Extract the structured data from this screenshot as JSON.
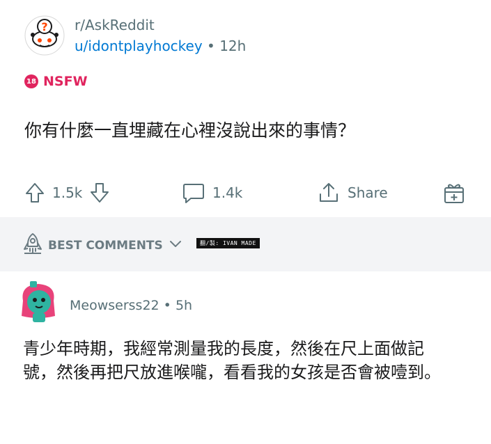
{
  "post": {
    "subreddit": "r/AskReddit",
    "username": "u/idontplayhockey",
    "separator": "•",
    "age": "12h",
    "nsfw_badge_number": "18",
    "nsfw_label": "NSFW",
    "title": "你有什麼一直埋藏在心裡沒說出來的事情？"
  },
  "actions": {
    "votes": "1.5k",
    "comments": "1.4k",
    "share_label": "Share"
  },
  "comments_bar": {
    "sort_label": "BEST COMMENTS",
    "credit": "翻/製: IVAN MADE"
  },
  "comment": {
    "author": "Meowserss22",
    "separator": "•",
    "age": "5h",
    "body": "青少年時期，我經常測量我的長度，然後在尺上面做記號，然後再把尺放進喉嚨，看看我的女孩是否會被噎到。"
  },
  "colors": {
    "link_blue": "#0079d3",
    "meta_gray": "#576f76",
    "nsfw_pink": "#e0245e",
    "bar_bg": "#f3f4f6",
    "avatar_pink": "#e8437a",
    "avatar_teal": "#2fb3a1"
  },
  "icons": [
    "askreddit-icon",
    "nsfw-icon",
    "upvote-icon",
    "downvote-icon",
    "comment-icon",
    "share-icon",
    "award-icon",
    "rocket-icon",
    "chevron-down-icon"
  ]
}
